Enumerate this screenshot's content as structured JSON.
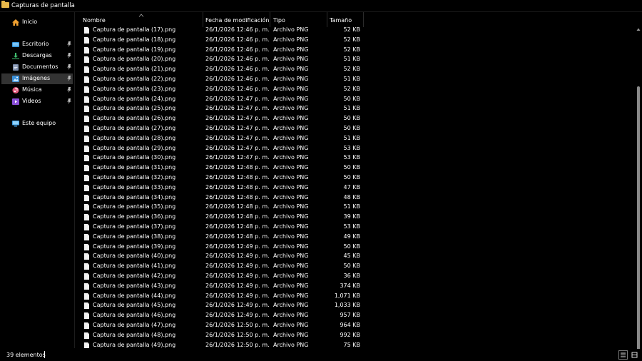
{
  "window": {
    "title": "Capturas de pantalla"
  },
  "nav": {
    "items": [
      {
        "label": "Inicio",
        "icon": "home-icon",
        "pinned": false,
        "selected": false
      },
      {
        "label": "Escritorio",
        "icon": "desktop-icon",
        "pinned": true,
        "selected": false
      },
      {
        "label": "Descargas",
        "icon": "download-icon",
        "pinned": true,
        "selected": false
      },
      {
        "label": "Documentos",
        "icon": "documents-icon",
        "pinned": true,
        "selected": false
      },
      {
        "label": "Imágenes",
        "icon": "pictures-icon",
        "pinned": true,
        "selected": true
      },
      {
        "label": "Música",
        "icon": "music-icon",
        "pinned": true,
        "selected": false
      },
      {
        "label": "Videos",
        "icon": "videos-icon",
        "pinned": true,
        "selected": false
      },
      {
        "label": "Este equipo",
        "icon": "computer-icon",
        "pinned": false,
        "selected": false
      }
    ]
  },
  "columns": {
    "name": "Nombre",
    "date": "Fecha de modificación",
    "type": "Tipo",
    "size": "Tamaño"
  },
  "files": [
    {
      "name": "Captura de pantalla (17).png",
      "date": "26/1/2026 12:46 p. m.",
      "type": "Archivo PNG",
      "size": "52 KB"
    },
    {
      "name": "Captura de pantalla (18).png",
      "date": "26/1/2026 12:46 p. m.",
      "type": "Archivo PNG",
      "size": "52 KB"
    },
    {
      "name": "Captura de pantalla (19).png",
      "date": "26/1/2026 12:46 p. m.",
      "type": "Archivo PNG",
      "size": "52 KB"
    },
    {
      "name": "Captura de pantalla (20).png",
      "date": "26/1/2026 12:46 p. m.",
      "type": "Archivo PNG",
      "size": "51 KB"
    },
    {
      "name": "Captura de pantalla (21).png",
      "date": "26/1/2026 12:46 p. m.",
      "type": "Archivo PNG",
      "size": "52 KB"
    },
    {
      "name": "Captura de pantalla (22).png",
      "date": "26/1/2026 12:46 p. m.",
      "type": "Archivo PNG",
      "size": "51 KB"
    },
    {
      "name": "Captura de pantalla (23).png",
      "date": "26/1/2026 12:46 p. m.",
      "type": "Archivo PNG",
      "size": "52 KB"
    },
    {
      "name": "Captura de pantalla (24).png",
      "date": "26/1/2026 12:47 p. m.",
      "type": "Archivo PNG",
      "size": "50 KB"
    },
    {
      "name": "Captura de pantalla (25).png",
      "date": "26/1/2026 12:47 p. m.",
      "type": "Archivo PNG",
      "size": "51 KB"
    },
    {
      "name": "Captura de pantalla (26).png",
      "date": "26/1/2026 12:47 p. m.",
      "type": "Archivo PNG",
      "size": "50 KB"
    },
    {
      "name": "Captura de pantalla (27).png",
      "date": "26/1/2026 12:47 p. m.",
      "type": "Archivo PNG",
      "size": "50 KB"
    },
    {
      "name": "Captura de pantalla (28).png",
      "date": "26/1/2026 12:47 p. m.",
      "type": "Archivo PNG",
      "size": "51 KB"
    },
    {
      "name": "Captura de pantalla (29).png",
      "date": "26/1/2026 12:47 p. m.",
      "type": "Archivo PNG",
      "size": "53 KB"
    },
    {
      "name": "Captura de pantalla (30).png",
      "date": "26/1/2026 12:47 p. m.",
      "type": "Archivo PNG",
      "size": "53 KB"
    },
    {
      "name": "Captura de pantalla (31).png",
      "date": "26/1/2026 12:48 p. m.",
      "type": "Archivo PNG",
      "size": "50 KB"
    },
    {
      "name": "Captura de pantalla (32).png",
      "date": "26/1/2026 12:48 p. m.",
      "type": "Archivo PNG",
      "size": "50 KB"
    },
    {
      "name": "Captura de pantalla (33).png",
      "date": "26/1/2026 12:48 p. m.",
      "type": "Archivo PNG",
      "size": "47 KB"
    },
    {
      "name": "Captura de pantalla (34).png",
      "date": "26/1/2026 12:48 p. m.",
      "type": "Archivo PNG",
      "size": "48 KB"
    },
    {
      "name": "Captura de pantalla (35).png",
      "date": "26/1/2026 12:48 p. m.",
      "type": "Archivo PNG",
      "size": "51 KB"
    },
    {
      "name": "Captura de pantalla (36).png",
      "date": "26/1/2026 12:48 p. m.",
      "type": "Archivo PNG",
      "size": "39 KB"
    },
    {
      "name": "Captura de pantalla (37).png",
      "date": "26/1/2026 12:48 p. m.",
      "type": "Archivo PNG",
      "size": "53 KB"
    },
    {
      "name": "Captura de pantalla (38).png",
      "date": "26/1/2026 12:48 p. m.",
      "type": "Archivo PNG",
      "size": "49 KB"
    },
    {
      "name": "Captura de pantalla (39).png",
      "date": "26/1/2026 12:49 p. m.",
      "type": "Archivo PNG",
      "size": "50 KB"
    },
    {
      "name": "Captura de pantalla (40).png",
      "date": "26/1/2026 12:49 p. m.",
      "type": "Archivo PNG",
      "size": "45 KB"
    },
    {
      "name": "Captura de pantalla (41).png",
      "date": "26/1/2026 12:49 p. m.",
      "type": "Archivo PNG",
      "size": "50 KB"
    },
    {
      "name": "Captura de pantalla (42).png",
      "date": "26/1/2026 12:49 p. m.",
      "type": "Archivo PNG",
      "size": "36 KB"
    },
    {
      "name": "Captura de pantalla (43).png",
      "date": "26/1/2026 12:49 p. m.",
      "type": "Archivo PNG",
      "size": "374 KB"
    },
    {
      "name": "Captura de pantalla (44).png",
      "date": "26/1/2026 12:49 p. m.",
      "type": "Archivo PNG",
      "size": "1,071 KB"
    },
    {
      "name": "Captura de pantalla (45).png",
      "date": "26/1/2026 12:49 p. m.",
      "type": "Archivo PNG",
      "size": "1,033 KB"
    },
    {
      "name": "Captura de pantalla (46).png",
      "date": "26/1/2026 12:49 p. m.",
      "type": "Archivo PNG",
      "size": "957 KB"
    },
    {
      "name": "Captura de pantalla (47).png",
      "date": "26/1/2026 12:50 p. m.",
      "type": "Archivo PNG",
      "size": "964 KB"
    },
    {
      "name": "Captura de pantalla (48).png",
      "date": "26/1/2026 12:50 p. m.",
      "type": "Archivo PNG",
      "size": "992 KB"
    },
    {
      "name": "Captura de pantalla (49).png",
      "date": "26/1/2026 12:50 p. m.",
      "type": "Archivo PNG",
      "size": "75 KB"
    }
  ],
  "status": {
    "count": "39 elementos"
  },
  "colors": {
    "background": "#000000",
    "selected": "#333333",
    "folder": "#e8b84a",
    "scrollbar_thumb": "#8a8a8a"
  }
}
